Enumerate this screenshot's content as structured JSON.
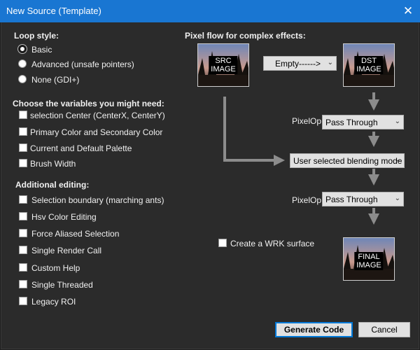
{
  "window": {
    "title": "New Source (Template)",
    "close_glyph": "✕"
  },
  "loop_style": {
    "heading": "Loop style:",
    "options": [
      "Basic",
      "Advanced (unsafe pointers)",
      "None (GDI+)"
    ],
    "selected": "Basic"
  },
  "variables": {
    "heading": "Choose the variables you might need:",
    "items": [
      "selection  Center  (CenterX, CenterY)",
      "Primary Color and Secondary Color",
      "Current and Default Palette",
      "Brush Width"
    ]
  },
  "additional": {
    "heading": "Additional editing:",
    "items": [
      "Selection boundary (marching ants)",
      "Hsv Color Editing",
      "Force Aliased Selection",
      "Single Render Call",
      "Custom Help",
      "Single Threaded",
      "Legacy ROI"
    ]
  },
  "pixel_flow": {
    "heading": "Pixel flow for complex effects:",
    "src_label_1": "SRC",
    "src_label_2": "IMAGE",
    "dst_label_1": "DST",
    "dst_label_2": "IMAGE",
    "final_label_1": "FINAL",
    "final_label_2": "IMAGE",
    "empty_combo": "Empty------>",
    "pixelop_label_1": "PixelOp",
    "pixelop_value_1": "Pass Through",
    "blend_combo": "User selected blending mode",
    "pixelop_label_2": "PixelOp",
    "pixelop_value_2": "Pass Through",
    "wrk_label": "Create a WRK surface"
  },
  "buttons": {
    "generate": "Generate Code",
    "cancel": "Cancel"
  },
  "colors": {
    "titlebar": "#1976d2",
    "background": "#2b2b2b",
    "arrow": "#8c8c8c",
    "accent": "#0078d7"
  }
}
